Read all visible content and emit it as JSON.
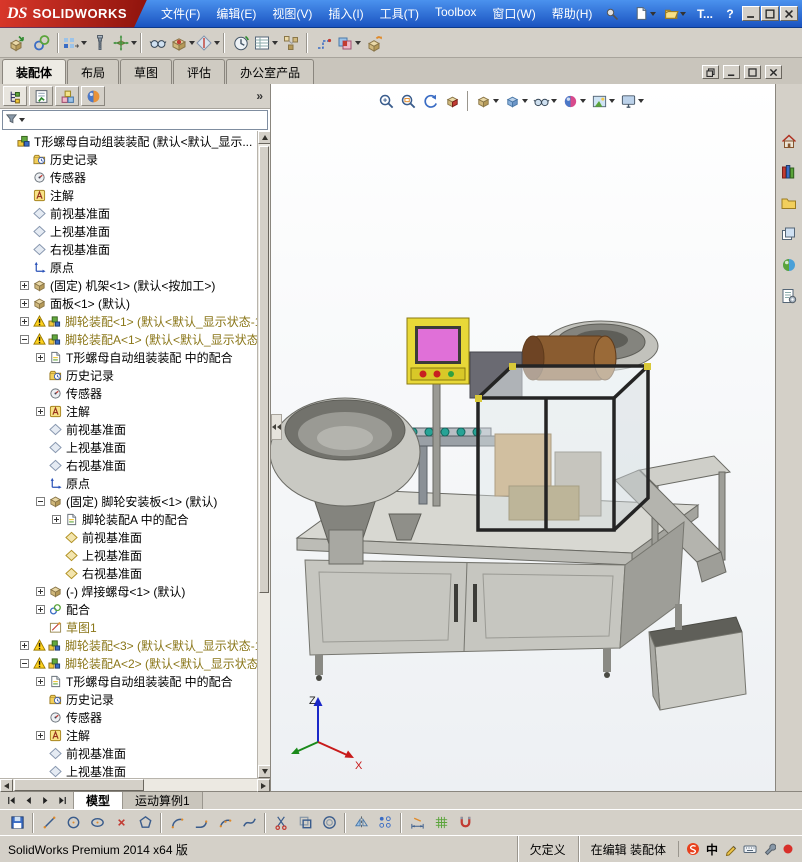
{
  "colors": {
    "titlebar_top": "#4b92ee",
    "titlebar_bottom": "#1a53c0",
    "logo_red": "#d8372a",
    "chrome": "#d4d0c8",
    "warning_text": "#8a7618",
    "viewport_top": "#ffffff",
    "viewport_bottom": "#edf0f3",
    "hmi_yellow": "#e8d838",
    "screen_pink": "#e070d8",
    "teal_part": "#27a396"
  },
  "titlebar": {
    "logo_mark": "DS",
    "logo_text": "SOLIDWORKS",
    "menus": [
      {
        "id": "file",
        "label": "文件(F)"
      },
      {
        "id": "edit",
        "label": "编辑(E)"
      },
      {
        "id": "view",
        "label": "视图(V)"
      },
      {
        "id": "insert",
        "label": "插入(I)"
      },
      {
        "id": "tools",
        "label": "工具(T)"
      },
      {
        "id": "toolbox",
        "label": "Toolbox"
      },
      {
        "id": "window",
        "label": "窗口(W)"
      },
      {
        "id": "help",
        "label": "帮助(H)"
      }
    ],
    "quick_icons": [
      {
        "name": "new-document",
        "caret": true
      },
      {
        "name": "open-document",
        "caret": true
      }
    ],
    "doc_title": "T...",
    "help_label": "?",
    "window_controls": [
      {
        "name": "window-minimize"
      },
      {
        "name": "window-maximize"
      },
      {
        "name": "window-close"
      }
    ]
  },
  "main_toolbar": {
    "icons": [
      {
        "name": "insert-component"
      },
      {
        "name": "mate"
      },
      {
        "sep": true
      },
      {
        "name": "linear-component-pattern",
        "caret": true
      },
      {
        "name": "smart-fasteners"
      },
      {
        "name": "move-component",
        "caret": true
      },
      {
        "sep": true
      },
      {
        "name": "show-hidden-components"
      },
      {
        "name": "assembly-features",
        "caret": true
      },
      {
        "name": "reference-geometry",
        "caret": true
      },
      {
        "sep": true
      },
      {
        "name": "new-motion-study"
      },
      {
        "name": "bill-of-materials",
        "caret": true
      },
      {
        "name": "exploded-view"
      },
      {
        "sep": true
      },
      {
        "name": "explode-line-sketch"
      },
      {
        "name": "interference-detection",
        "caret": true
      },
      {
        "name": "instant3d"
      }
    ]
  },
  "command_tabs": {
    "tabs": [
      {
        "label": "装配体",
        "active": true
      },
      {
        "label": "布局",
        "active": false
      },
      {
        "label": "草图",
        "active": false
      },
      {
        "label": "评估",
        "active": false
      },
      {
        "label": "办公室产品",
        "active": false
      }
    ],
    "doc_window_controls": [
      {
        "name": "window-restore"
      },
      {
        "name": "window-minimize"
      },
      {
        "name": "window-maximize"
      },
      {
        "name": "window-close"
      }
    ]
  },
  "feature_panel": {
    "tabs": [
      {
        "name": "featuremanager",
        "active": true
      },
      {
        "name": "propertymanager",
        "active": false
      },
      {
        "name": "configurationmanager",
        "active": false
      },
      {
        "name": "displaymanager",
        "active": false
      }
    ],
    "overflow_label": "»",
    "filter": {
      "value": ""
    },
    "tree": {
      "items": [
        {
          "d": 0,
          "i": [
            "assembly"
          ],
          "t": "T形螺母自动组装装配 (默认<默认_显示..."
        },
        {
          "d": 1,
          "i": [
            "history"
          ],
          "t": "历史记录"
        },
        {
          "d": 1,
          "i": [
            "sensor"
          ],
          "t": "传感器"
        },
        {
          "d": 1,
          "i": [
            "annotation"
          ],
          "t": "注解"
        },
        {
          "d": 1,
          "i": [
            "plane"
          ],
          "t": "前视基准面"
        },
        {
          "d": 1,
          "i": [
            "plane"
          ],
          "t": "上视基准面"
        },
        {
          "d": 1,
          "i": [
            "plane"
          ],
          "t": "右视基准面"
        },
        {
          "d": 1,
          "i": [
            "origin"
          ],
          "t": "原点"
        },
        {
          "d": 1,
          "x": "plus",
          "i": [
            "part"
          ],
          "t": "(固定) 机架<1> (默认<按加工>)"
        },
        {
          "d": 1,
          "x": "plus",
          "i": [
            "part"
          ],
          "t": "面板<1> (默认)"
        },
        {
          "d": 1,
          "x": "plus",
          "i": [
            "warning",
            "subassembly"
          ],
          "t": "脚轮装配<1> (默认<默认_显示状态-1",
          "g": true
        },
        {
          "d": 1,
          "x": "minus",
          "i": [
            "warning",
            "subassembly"
          ],
          "t": "脚轮装配A<1> (默认<默认_显示状态-",
          "g": true
        },
        {
          "d": 2,
          "x": "plus",
          "i": [
            "inplace-mates"
          ],
          "t": "T形螺母自动组装装配 中的配合"
        },
        {
          "d": 2,
          "i": [
            "history"
          ],
          "t": "历史记录"
        },
        {
          "d": 2,
          "i": [
            "sensor"
          ],
          "t": "传感器"
        },
        {
          "d": 2,
          "x": "plus",
          "i": [
            "annotation"
          ],
          "t": "注解"
        },
        {
          "d": 2,
          "i": [
            "plane"
          ],
          "t": "前视基准面"
        },
        {
          "d": 2,
          "i": [
            "plane"
          ],
          "t": "上视基准面"
        },
        {
          "d": 2,
          "i": [
            "plane"
          ],
          "t": "右视基准面"
        },
        {
          "d": 2,
          "i": [
            "origin"
          ],
          "t": "原点"
        },
        {
          "d": 2,
          "x": "minus",
          "i": [
            "part"
          ],
          "t": "(固定) 脚轮安装板<1> (默认)"
        },
        {
          "d": 3,
          "x": "plus",
          "i": [
            "inplace-mates"
          ],
          "t": "脚轮装配A 中的配合"
        },
        {
          "d": 3,
          "i": [
            "plane-gold"
          ],
          "t": "前视基准面"
        },
        {
          "d": 3,
          "i": [
            "plane-gold"
          ],
          "t": "上视基准面"
        },
        {
          "d": 3,
          "i": [
            "plane-gold"
          ],
          "t": "右视基准面"
        },
        {
          "d": 2,
          "x": "plus",
          "i": [
            "part"
          ],
          "t": "(-) 焊接螺母<1> (默认)"
        },
        {
          "d": 2,
          "x": "plus",
          "i": [
            "mates"
          ],
          "t": "配合"
        },
        {
          "d": 2,
          "i": [
            "sketch"
          ],
          "t": "草图1",
          "g": true
        },
        {
          "d": 1,
          "x": "plus",
          "i": [
            "warning",
            "subassembly"
          ],
          "t": "脚轮装配<3> (默认<默认_显示状态-1",
          "g": true
        },
        {
          "d": 1,
          "x": "minus",
          "i": [
            "warning",
            "subassembly"
          ],
          "t": "脚轮装配A<2> (默认<默认_显示状态_",
          "g": true
        },
        {
          "d": 2,
          "x": "plus",
          "i": [
            "inplace-mates"
          ],
          "t": "T形螺母自动组装装配 中的配合"
        },
        {
          "d": 2,
          "i": [
            "history"
          ],
          "t": "历史记录"
        },
        {
          "d": 2,
          "i": [
            "sensor"
          ],
          "t": "传感器"
        },
        {
          "d": 2,
          "x": "plus",
          "i": [
            "annotation"
          ],
          "t": "注解"
        },
        {
          "d": 2,
          "i": [
            "plane"
          ],
          "t": "前视基准面"
        },
        {
          "d": 2,
          "i": [
            "plane"
          ],
          "t": "上视基准面"
        }
      ]
    }
  },
  "viewport": {
    "headsup": [
      {
        "name": "zoom-fit"
      },
      {
        "name": "zoom-area"
      },
      {
        "name": "previous-view"
      },
      {
        "name": "section-view"
      },
      {
        "sep": true
      },
      {
        "name": "view-orientation",
        "caret": true
      },
      {
        "name": "display-style",
        "caret": true
      },
      {
        "name": "hide-show-items",
        "caret": true
      },
      {
        "name": "edit-appearance",
        "caret": true
      },
      {
        "name": "apply-scene",
        "caret": true
      },
      {
        "name": "view-settings",
        "caret": true
      }
    ],
    "triad": {
      "z": "Z",
      "x": "X"
    },
    "taskpane": [
      {
        "name": "home"
      },
      {
        "name": "design-library"
      },
      {
        "name": "file-explorer"
      },
      {
        "name": "view-palette"
      },
      {
        "name": "appearances"
      },
      {
        "name": "custom-properties"
      }
    ]
  },
  "sheet_tabs": {
    "nav": [
      {
        "name": "nav-first"
      },
      {
        "name": "nav-prev"
      },
      {
        "name": "nav-next"
      },
      {
        "name": "nav-last"
      }
    ],
    "tabs": [
      {
        "label": "模型",
        "active": true
      },
      {
        "label": "运动算例1",
        "active": false
      }
    ]
  },
  "sketch_toolbar": {
    "icons": [
      {
        "name": "save"
      },
      {
        "sep": true
      },
      {
        "name": "line"
      },
      {
        "name": "circle"
      },
      {
        "name": "ellipse"
      },
      {
        "name": "point"
      },
      {
        "name": "polygon"
      },
      {
        "sep": true
      },
      {
        "name": "arc"
      },
      {
        "name": "tangent-arc"
      },
      {
        "name": "three-point-arc"
      },
      {
        "name": "spline"
      },
      {
        "sep": true
      },
      {
        "name": "trim"
      },
      {
        "name": "convert-entities"
      },
      {
        "name": "offset-entities"
      },
      {
        "sep": true
      },
      {
        "name": "mirror"
      },
      {
        "name": "linear-sketch-pattern"
      },
      {
        "sep": true
      },
      {
        "name": "smart-dimension"
      },
      {
        "name": "grid"
      },
      {
        "name": "quick-snaps"
      }
    ]
  },
  "statusbar": {
    "product": "SolidWorks Premium 2014 x64 版",
    "definition_state": "欠定义",
    "edit_state": "在编辑 装配体",
    "tray": [
      {
        "name": "sogou"
      },
      {
        "name": "ime-language",
        "text": "中"
      },
      {
        "name": "pen"
      },
      {
        "name": "keyboard"
      },
      {
        "name": "wrench"
      },
      {
        "name": "red-dot"
      }
    ]
  }
}
